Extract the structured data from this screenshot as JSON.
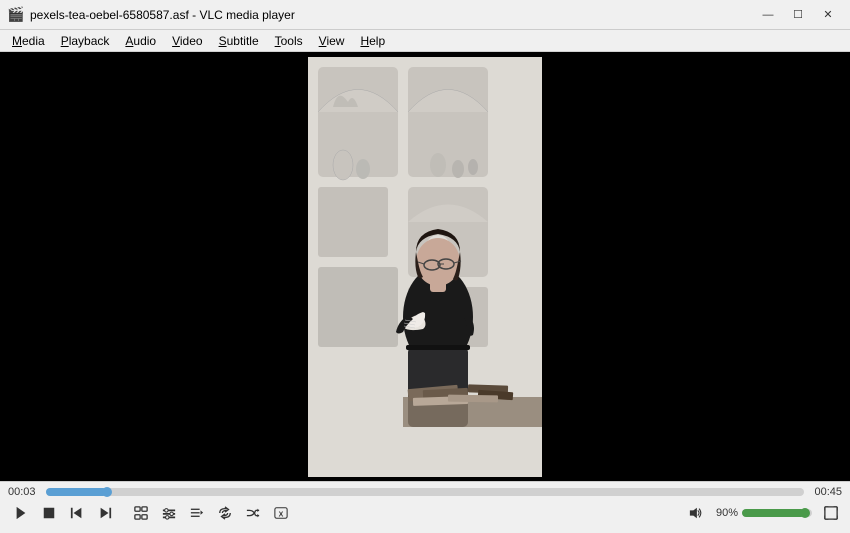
{
  "window": {
    "title": "pexels-tea-oebel-6580587.asf - VLC media player",
    "icon": "🎬"
  },
  "window_controls": {
    "minimize": "—",
    "maximize": "☐",
    "close": "✕"
  },
  "menu": {
    "items": [
      {
        "label": "Media",
        "underline_index": 0
      },
      {
        "label": "Playback",
        "underline_index": 0
      },
      {
        "label": "Audio",
        "underline_index": 0
      },
      {
        "label": "Video",
        "underline_index": 0
      },
      {
        "label": "Subtitle",
        "underline_index": 0
      },
      {
        "label": "Tools",
        "underline_index": 0
      },
      {
        "label": "View",
        "underline_index": 0
      },
      {
        "label": "Help",
        "underline_index": 0
      }
    ]
  },
  "playback": {
    "current_time": "00:03",
    "total_time": "00:45",
    "progress_percent": 8,
    "volume_percent": 90,
    "volume_label": "90%"
  },
  "controls": {
    "play_label": "Play",
    "stop_label": "Stop",
    "prev_label": "Previous",
    "next_label": "Next",
    "skip_back_label": "Skip Back",
    "skip_forward_label": "Skip Forward",
    "playlist_label": "Playlist",
    "loop_label": "Loop",
    "random_label": "Random",
    "extended_label": "Extended Settings",
    "volume_label": "Volume",
    "fullscreen_label": "Fullscreen"
  }
}
